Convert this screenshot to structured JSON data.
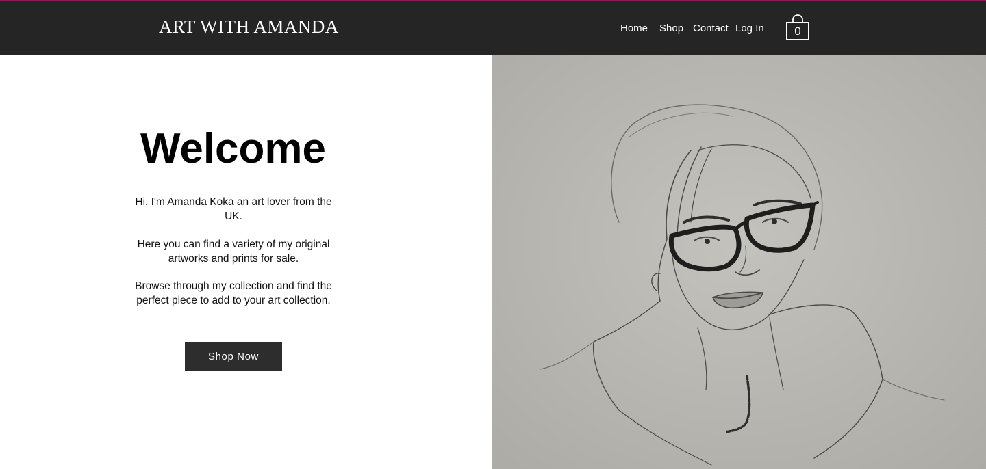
{
  "header": {
    "brand": "ART WITH AMANDA",
    "nav": [
      {
        "label": "Home"
      },
      {
        "label": "Shop"
      },
      {
        "label": "Contact"
      },
      {
        "label": "Log In"
      }
    ],
    "cart_count": "0"
  },
  "hero": {
    "title": "Welcome",
    "paragraphs": [
      "Hi, I'm Amanda Koka an art lover from the UK.",
      "Here you can find a variety of my original artworks and prints for sale.",
      "Browse through my collection and find the perfect piece to add to your art collection."
    ],
    "button_label": "Shop Now"
  },
  "image": {
    "subject": "pencil-sketch-portrait"
  },
  "colors": {
    "header_bg": "#252525",
    "accent_line": "#8a1a5a",
    "button_bg": "#2d2d2d",
    "paper": "#b9b8b2"
  },
  "icons": [
    "shopping-bag-icon"
  ]
}
